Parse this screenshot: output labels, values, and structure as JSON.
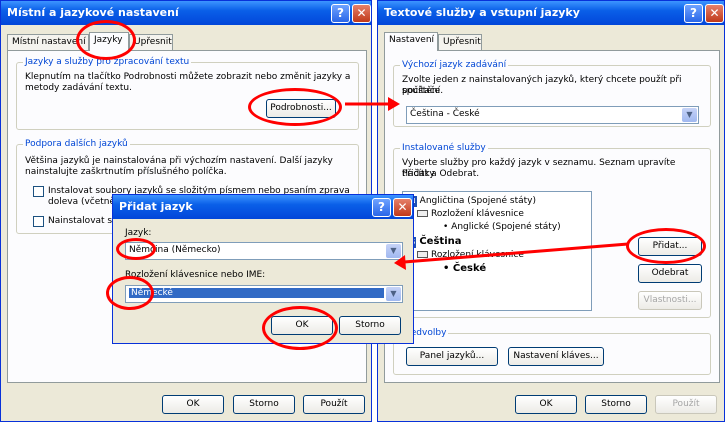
{
  "left_window": {
    "title": "Místní a jazykové nastavení",
    "tabs": [
      "Místní nastavení",
      "Jazyky",
      "Upřesnit"
    ],
    "group1_label": "Jazyky a služby pro zpracování textu",
    "group1_text_line1": "Klepnutím na tlačítko Podrobnosti můžete zobrazit nebo změnit jazyky a",
    "group1_text_line2": "metody zadávání textu.",
    "details_button": "Podrobnosti...",
    "group2_label": "Podpora dalších jazyků",
    "group2_text_line1": "Většina jazyků je nainstalována při výchozím nastavení. Další jazyky",
    "group2_text_line2": "nainstalujte zaškrtnutím příslušného políčka.",
    "checkbox1_line1": "Instalovat soubory jazyků se složitým písmem nebo psaním zprava",
    "checkbox1_line2": "doleva (včetně t",
    "checkbox2": "Nainstalovat sou",
    "ok": "OK",
    "cancel": "Storno",
    "apply": "Použít"
  },
  "right_window": {
    "title": "Textové služby a vstupní jazyky",
    "tabs": [
      "Nastavení",
      "Upřesnit"
    ],
    "default_label": "Výchozí jazyk zadávání",
    "default_text_line1": "Zvolte jeden z nainstalovaných jazyků, který chcete použít při spuštění",
    "default_text_line2": "počítače.",
    "default_value": "Čeština - České",
    "installed_label": "Instalované služby",
    "installed_text_line1": "Vyberte služby pro každý jazyk v seznamu. Seznam upravíte tlačítky",
    "installed_text_line2": "Přidat a Odebrat.",
    "tree": {
      "lang1_code": "EN",
      "lang1": "Angličtina (Spojené státy)",
      "lang1_layout_group": "Rozložení klávesnice",
      "lang1_layout": "Anglické (Spojené státy)",
      "lang2_code": "CS",
      "lang2": "Čeština",
      "lang2_layout_group": "Rozložení klávesnice",
      "lang2_layout": "České"
    },
    "add_button": "Přidat...",
    "remove_button": "Odebrat",
    "properties_button": "Vlastnosti...",
    "prefs_label": "Předvolby",
    "language_bar_button": "Panel jazyků...",
    "key_settings_button": "Nastavení kláves...",
    "ok": "OK",
    "cancel": "Storno",
    "apply": "Použít"
  },
  "add_dialog": {
    "title": "Přidat jazyk",
    "language_label": "Jazyk:",
    "language_value": "Němčina (Německo)",
    "keyboard_label": "Rozložení klávesnice nebo IME:",
    "keyboard_value": "Německé",
    "ok": "OK",
    "cancel": "Storno"
  },
  "colors": {
    "titlebar": "#0a5fe8",
    "annotation": "#ff0000",
    "selection": "#316ac5"
  }
}
